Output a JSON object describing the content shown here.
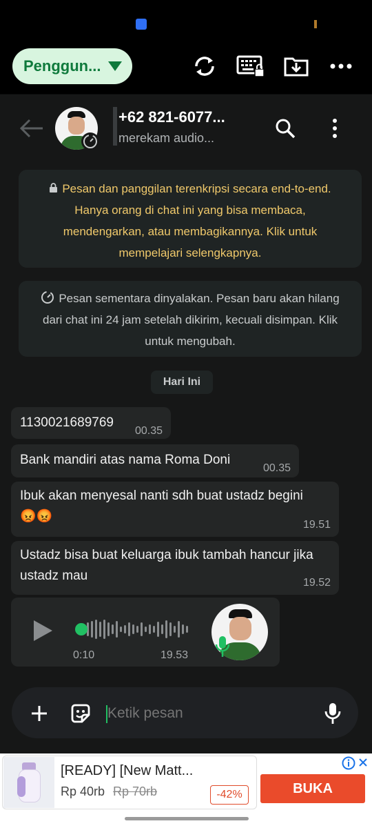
{
  "toolbar": {
    "user_pill": "Penggun...",
    "icons": [
      "refresh-icon",
      "keyboard-lock-icon",
      "download-folder-icon",
      "more-horizontal-icon"
    ]
  },
  "chat_header": {
    "name": "+62 821-6077...",
    "subtitle": "merekam audio..."
  },
  "system": {
    "encryption": "Pesan dan panggilan terenkripsi secara end-to-end. Hanya orang di chat ini yang bisa membaca, mendengarkan, atau membagikannya. Klik untuk mempelajari selengkapnya.",
    "ephemeral": "Pesan sementara dinyalakan. Pesan baru akan hilang dari chat ini 24 jam setelah dikirim, kecuali disimpan. Klik untuk mengubah.",
    "date_chip": "Hari Ini"
  },
  "messages": [
    {
      "text": "1130021689769",
      "time": "00.35"
    },
    {
      "text": "Bank mandiri atas nama Roma Doni",
      "time": "00.35"
    },
    {
      "text": "Ibuk akan menyesal nanti sdh buat ustadz begini 😡😡",
      "time": "19.51"
    },
    {
      "text": "Ustadz bisa buat keluarga ibuk tambah hancur jika ustadz mau",
      "time": "19.52"
    }
  ],
  "voice_note": {
    "duration": "0:10",
    "time": "19.53",
    "played_fraction": 0.0
  },
  "input": {
    "placeholder": "Ketik pesan"
  },
  "ad": {
    "title": "[READY] [New Matt...",
    "price": "Rp 40rb",
    "old_price": "Rp 70rb",
    "discount": "-42%",
    "button": "BUKA"
  },
  "colors": {
    "accent_green": "#21c063",
    "system_yellow": "#f0c96b",
    "bubble": "#242626",
    "ad_button": "#ea4b2b"
  }
}
